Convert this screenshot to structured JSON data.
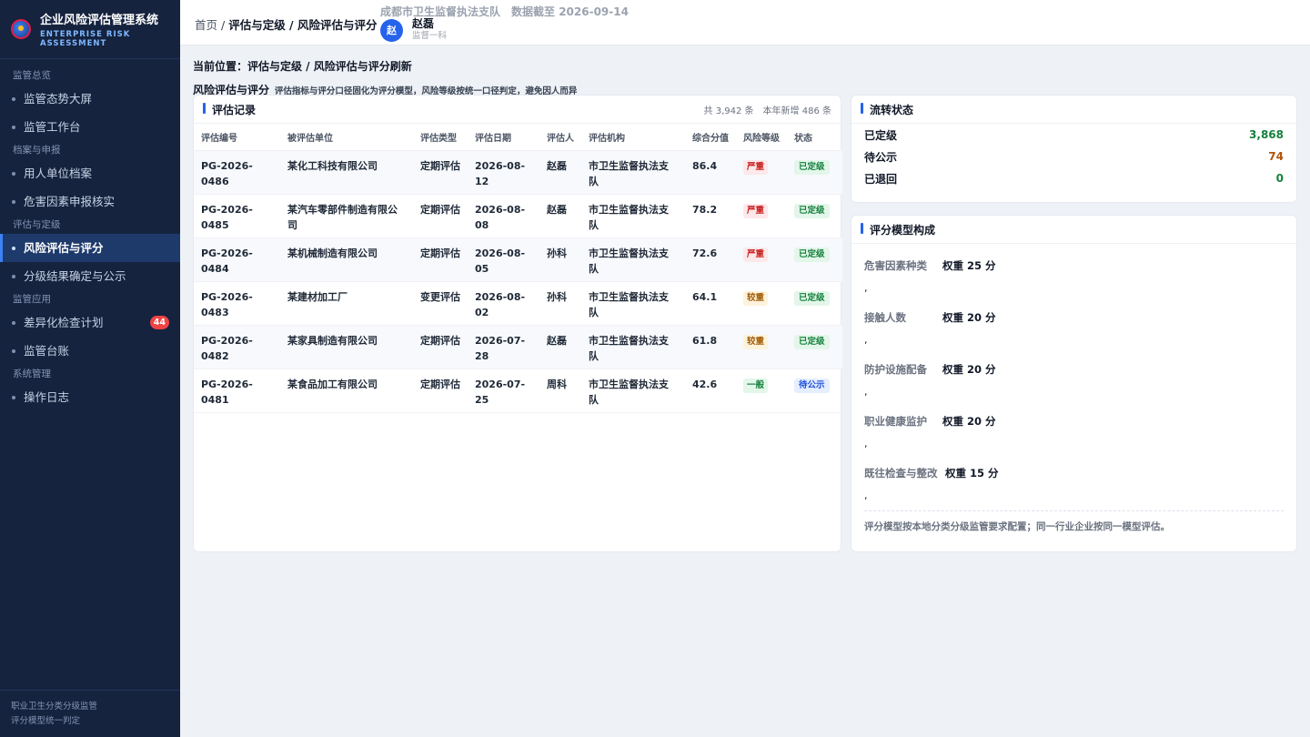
{
  "brand": {
    "title": "企业风险评估管理系统",
    "subtitle_line1": "ENTERPRISE RISK",
    "subtitle_line2": "ASSESSMENT"
  },
  "sidebar": {
    "groups": [
      {
        "label": "监管总览",
        "items": [
          {
            "label": "监管态势大屏"
          },
          {
            "label": "监管工作台"
          }
        ]
      },
      {
        "label": "档案与申报",
        "items": [
          {
            "label": "用人单位档案"
          },
          {
            "label": "危害因素申报核实"
          }
        ]
      },
      {
        "label": "评估与定级",
        "items": [
          {
            "label": "风险评估与评分",
            "active": true
          },
          {
            "label": "分级结果确定与公示"
          }
        ]
      },
      {
        "label": "监管应用",
        "items": [
          {
            "label": "差异化检查计划",
            "badge": "44"
          },
          {
            "label": "监管台账"
          }
        ]
      },
      {
        "label": "系统管理",
        "items": [
          {
            "label": "操作日志"
          }
        ]
      }
    ],
    "footer_line1": "职业卫生分类分级监管",
    "footer_line2": "评分模型统一判定"
  },
  "header": {
    "breadcrumb_home": "首页",
    "breadcrumb_sep": " / ",
    "breadcrumb_current": "评估与定级 / 风险评估与评分",
    "org": "成都市卫生监督执法支队",
    "data_date": "数据截至 2026-09-14",
    "user": {
      "avatar": "赵",
      "name": "赵磊",
      "dept": "监督一科"
    }
  },
  "main": {
    "location": "当前位置：评估与定级 / 风险评估与评分刷新",
    "page_title": "风险评估与评分",
    "page_desc": "评估指标与评分口径固化为评分模型，风险等级按统一口径判定，避免因人而异"
  },
  "records": {
    "title": "评估记录",
    "total": "共 3,942 条",
    "new_this_year": "本年新增 486 条",
    "columns": [
      "评估编号",
      "被评估单位",
      "评估类型",
      "评估日期",
      "评估人",
      "评估机构",
      "综合分值",
      "风险等级",
      "状态"
    ],
    "rows": [
      {
        "id": "PG-2026-0486",
        "unit": "某化工科技有限公司",
        "type": "定期评估",
        "date": "2026-08-12",
        "assessor": "赵磊",
        "org": "市卫生监督执法支队",
        "score": "86.4",
        "level": "严重",
        "level_kind": "severe",
        "status": "已定级",
        "status_kind": "done"
      },
      {
        "id": "PG-2026-0485",
        "unit": "某汽车零部件制造有限公司",
        "type": "定期评估",
        "date": "2026-08-08",
        "assessor": "赵磊",
        "org": "市卫生监督执法支队",
        "score": "78.2",
        "level": "严重",
        "level_kind": "severe",
        "status": "已定级",
        "status_kind": "done"
      },
      {
        "id": "PG-2026-0484",
        "unit": "某机械制造有限公司",
        "type": "定期评估",
        "date": "2026-08-05",
        "assessor": "孙科",
        "org": "市卫生监督执法支队",
        "score": "72.6",
        "level": "严重",
        "level_kind": "severe",
        "status": "已定级",
        "status_kind": "done"
      },
      {
        "id": "PG-2026-0483",
        "unit": "某建材加工厂",
        "type": "变更评估",
        "date": "2026-08-02",
        "assessor": "孙科",
        "org": "市卫生监督执法支队",
        "score": "64.1",
        "level": "较重",
        "level_kind": "high",
        "status": "已定级",
        "status_kind": "done"
      },
      {
        "id": "PG-2026-0482",
        "unit": "某家具制造有限公司",
        "type": "定期评估",
        "date": "2026-07-28",
        "assessor": "赵磊",
        "org": "市卫生监督执法支队",
        "score": "61.8",
        "level": "较重",
        "level_kind": "high",
        "status": "已定级",
        "status_kind": "done"
      },
      {
        "id": "PG-2026-0481",
        "unit": "某食品加工有限公司",
        "type": "定期评估",
        "date": "2026-07-25",
        "assessor": "周科",
        "org": "市卫生监督执法支队",
        "score": "42.6",
        "level": "一般",
        "level_kind": "normal",
        "status": "待公示",
        "status_kind": "pending"
      }
    ]
  },
  "flow": {
    "title": "流转状态",
    "items": [
      {
        "label": "已定级",
        "value": "3,868",
        "color": "#15803d"
      },
      {
        "label": "待公示",
        "value": "74",
        "color": "#b45309"
      },
      {
        "label": "已退回",
        "value": "0",
        "color": "#15803d"
      }
    ]
  },
  "model": {
    "title": "评分模型构成",
    "factors": [
      {
        "name": "危害因素种类",
        "weight": "权重 25 分"
      },
      {
        "name": "接触人数",
        "weight": "权重 20 分"
      },
      {
        "name": "防护设施配备",
        "weight": "权重 20 分"
      },
      {
        "name": "职业健康监护",
        "weight": "权重 20 分"
      },
      {
        "name": "既往检查与整改",
        "weight": "权重 15 分"
      }
    ],
    "separator": ",",
    "note": "评分模型按本地分类分级监管要求配置；同一行业企业按同一模型评估。"
  },
  "colors": {
    "sidebar_bg": "#15233f",
    "accent": "#2563eb",
    "severe": "#c81e1e",
    "high": "#a15c07",
    "normal": "#15803d"
  }
}
